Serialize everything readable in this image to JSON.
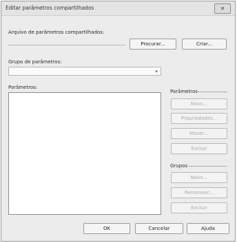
{
  "window": {
    "title": "Editar parâmetros compartilhados"
  },
  "file_section": {
    "label": "Arquivo de parâmetros compartilhados:",
    "path_value": "",
    "browse_button": "Procurar...",
    "create_button": "Criar..."
  },
  "group_section": {
    "label": "Grupo de parâmetros:",
    "selected": ""
  },
  "parameters_list": {
    "label": "Parâmetros:",
    "items": []
  },
  "parameters_panel": {
    "heading": "Parâmetros",
    "new_button": "Novo...",
    "properties_button": "Propriedades...",
    "move_button": "Mover...",
    "delete_button": "Excluir"
  },
  "groups_panel": {
    "heading": "Grupos",
    "new_button": "Novo...",
    "rename_button": "Renomear...",
    "delete_button": "Excluir"
  },
  "footer": {
    "ok_button": "OK",
    "cancel_button": "Cancelar",
    "help_button": "Ajuda"
  }
}
